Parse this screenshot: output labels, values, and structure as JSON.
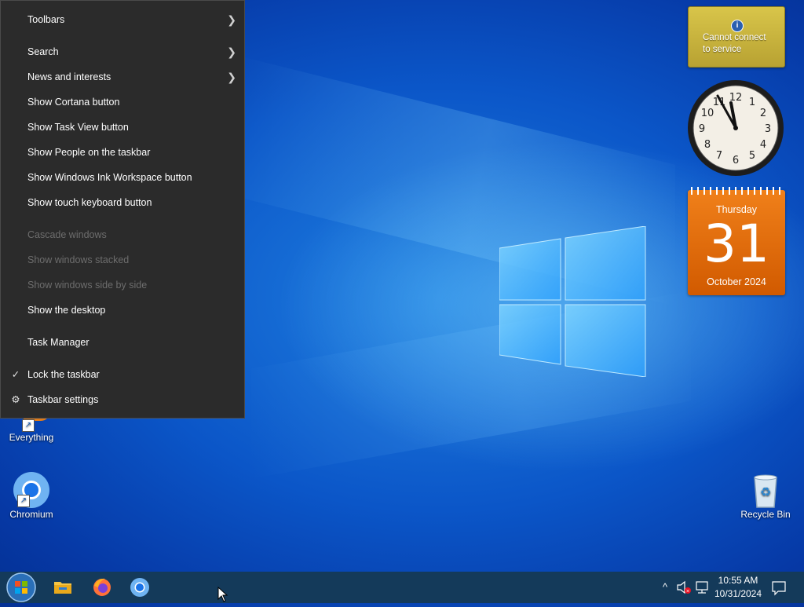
{
  "context_menu": {
    "items": [
      {
        "label": "Toolbars",
        "submenu": true,
        "enabled": true
      },
      {
        "label": "Search",
        "submenu": true,
        "enabled": true
      },
      {
        "label": "News and interests",
        "submenu": true,
        "enabled": true
      },
      {
        "label": "Show Cortana button",
        "enabled": true
      },
      {
        "label": "Show Task View button",
        "enabled": true
      },
      {
        "label": "Show People on the taskbar",
        "enabled": true
      },
      {
        "label": "Show Windows Ink Workspace button",
        "enabled": true
      },
      {
        "label": "Show touch keyboard button",
        "enabled": true
      },
      {
        "label": "Cascade windows",
        "enabled": false
      },
      {
        "label": "Show windows stacked",
        "enabled": false
      },
      {
        "label": "Show windows side by side",
        "enabled": false
      },
      {
        "label": "Show the desktop",
        "enabled": true
      },
      {
        "label": "Task Manager",
        "enabled": true
      },
      {
        "label": "Lock the taskbar",
        "enabled": true,
        "checked": true
      },
      {
        "label": "Taskbar settings",
        "enabled": true,
        "icon": "gear-icon"
      }
    ]
  },
  "gadgets": {
    "weather": {
      "message_line1": "Cannot connect",
      "message_line2": "to service",
      "icon": "info-icon"
    },
    "clock": {
      "hour": 11,
      "minute": 55
    },
    "calendar": {
      "day_name": "Thursday",
      "day_number": "31",
      "month_year": "October 2024"
    }
  },
  "desktop_icons": [
    {
      "label": "Everything",
      "icon": "everything-icon"
    },
    {
      "label": "Chromium",
      "icon": "chromium-icon"
    },
    {
      "label": "Recycle Bin",
      "icon": "recycle-bin-icon"
    }
  ],
  "taskbar": {
    "pinned": [
      {
        "name": "start-button",
        "icon": "windows-logo-icon"
      },
      {
        "name": "file-explorer",
        "icon": "folder-icon"
      },
      {
        "name": "firefox",
        "icon": "firefox-icon"
      },
      {
        "name": "chromium",
        "icon": "chromium-icon"
      }
    ],
    "tray": {
      "time": "10:55 AM",
      "date": "10/31/2024"
    }
  },
  "colors": {
    "menu_bg": "#2b2b2b",
    "taskbar_bg": "#143a5a",
    "calendar": "#e0680e",
    "weather": "#c9b43d"
  }
}
